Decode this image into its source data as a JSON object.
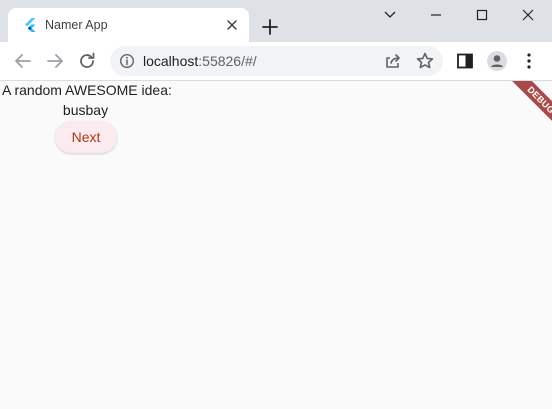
{
  "browser": {
    "tab": {
      "title": "Namer App",
      "favicon": "flutter-icon"
    },
    "new_tab_icon": "plus-icon",
    "window_controls": [
      "chevron-down-icon",
      "minimize-icon",
      "maximize-icon",
      "close-icon"
    ],
    "toolbar": {
      "back_icon": "arrow-left-icon",
      "forward_icon": "arrow-right-icon",
      "reload_icon": "reload-icon",
      "site_info_icon": "info-icon",
      "url_host": "localhost",
      "url_rest": ":55826/#/",
      "share_icon": "share-icon",
      "bookmark_icon": "star-icon",
      "side_panel_icon": "side-panel-icon",
      "profile_icon": "profile-icon",
      "menu_icon": "kebab-menu-icon"
    }
  },
  "app": {
    "idea_label": "A random AWESOME idea:",
    "word_pair": "busbay",
    "next_button_label": "Next",
    "debug_banner": "DEBUG"
  },
  "colors": {
    "tabstrip": "#dee1e6",
    "page_background": "#fafafa",
    "button_background": "#f9ebee",
    "button_text": "#b3341c",
    "debug_banner": "#a84a4a"
  }
}
